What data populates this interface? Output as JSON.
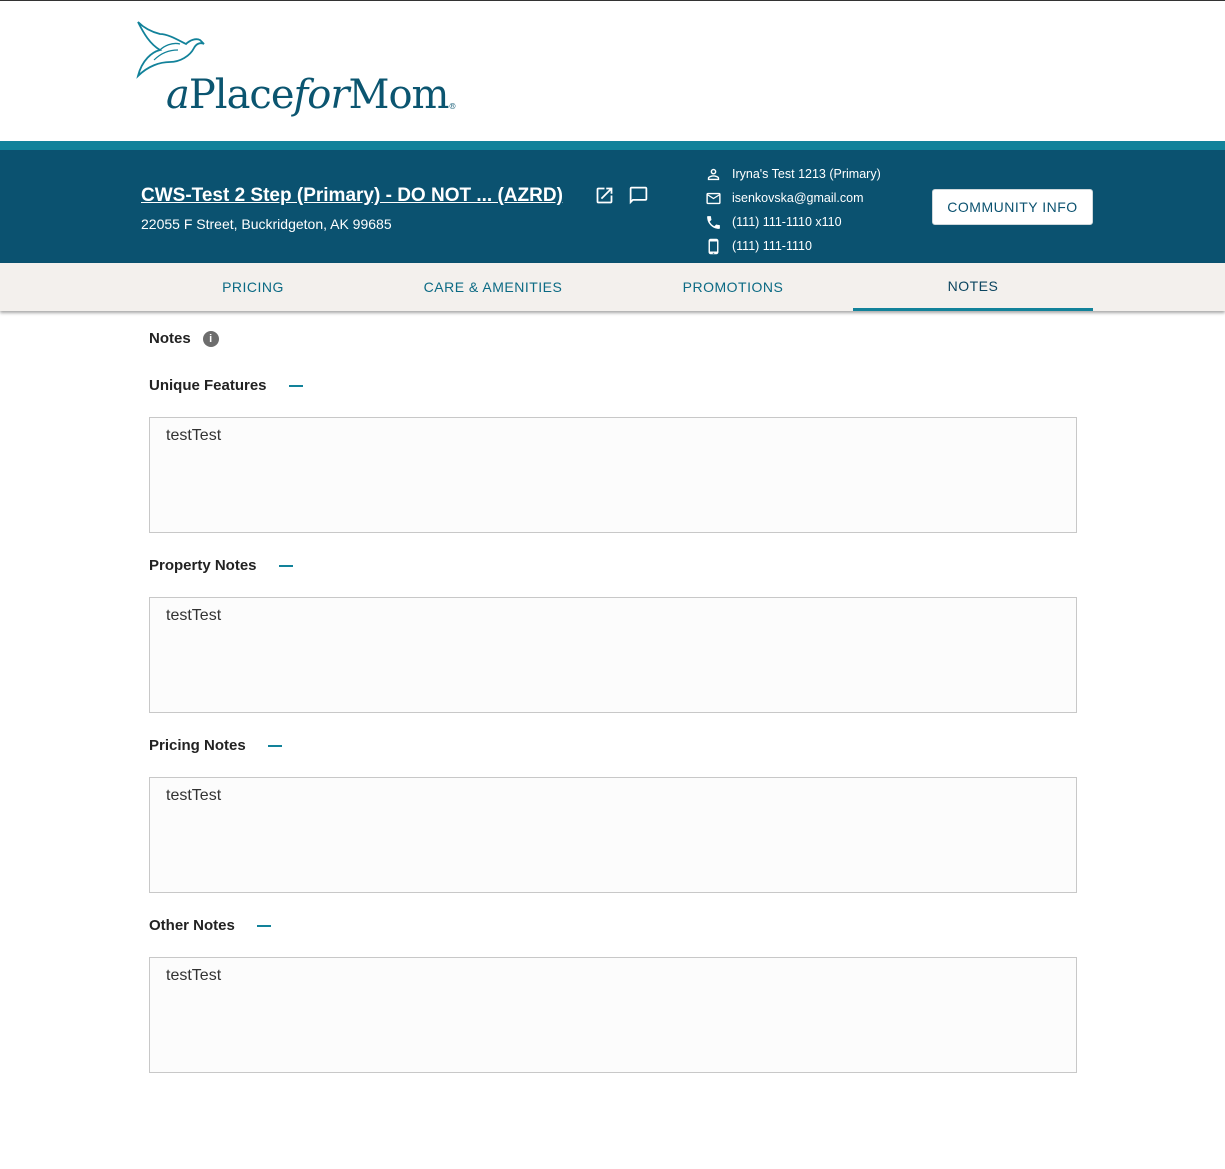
{
  "brand": {
    "logo_text_a": "a",
    "logo_text_place": "Place",
    "logo_text_for": "for",
    "logo_text_mom": "Mom",
    "logo_mark": "®",
    "primary_color": "#0b5270",
    "accent_color": "#12829a"
  },
  "header": {
    "community_title": "CWS-Test 2 Step (Primary) - DO NOT ... (AZRD)",
    "address": "22055 F Street, Buckridgeton, AK 99685",
    "icons": [
      "open-in-new-icon",
      "comment-icon"
    ],
    "contacts": [
      {
        "icon": "person-icon",
        "text": "Iryna's Test 1213 (Primary)"
      },
      {
        "icon": "email-icon",
        "text": "isenkovska@gmail.com"
      },
      {
        "icon": "phone-icon",
        "text": "(111) 111-1110 x110"
      },
      {
        "icon": "mobile-icon",
        "text": "(111) 111-1110"
      }
    ],
    "community_info_button": "COMMUNITY INFO"
  },
  "tabs": [
    {
      "label": "PRICING",
      "active": false
    },
    {
      "label": "CARE & AMENITIES",
      "active": false
    },
    {
      "label": "PROMOTIONS",
      "active": false
    },
    {
      "label": "NOTES",
      "active": true
    }
  ],
  "notes": {
    "heading": "Notes",
    "info_icon": "i",
    "sections": [
      {
        "label": "Unique Features",
        "value": "testTest"
      },
      {
        "label": "Property Notes",
        "value": "testTest"
      },
      {
        "label": "Pricing Notes",
        "value": "testTest"
      },
      {
        "label": "Other Notes",
        "value": "testTest"
      }
    ]
  }
}
